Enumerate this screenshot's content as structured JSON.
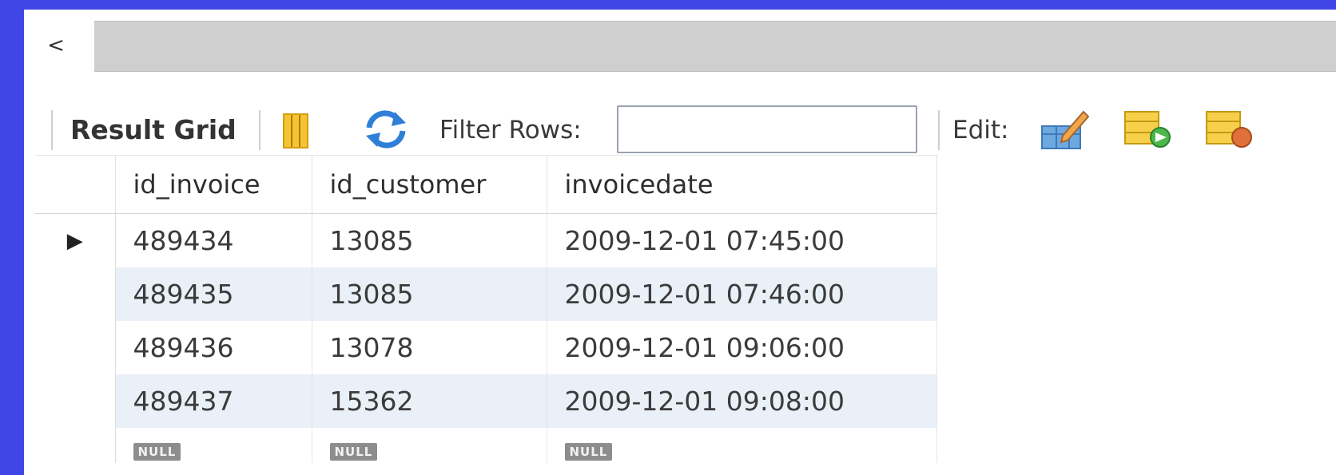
{
  "scroll": {
    "left_arrow": "<"
  },
  "toolbar": {
    "result_grid_label": "Result Grid",
    "filter_label": "Filter Rows:",
    "filter_value": "",
    "edit_label": "Edit:"
  },
  "grid": {
    "columns": [
      "id_invoice",
      "id_customer",
      "invoicedate"
    ],
    "current_row_marker": "▶",
    "rows": [
      [
        "489434",
        "13085",
        "2009-12-01 07:45:00"
      ],
      [
        "489435",
        "13085",
        "2009-12-01 07:46:00"
      ],
      [
        "489436",
        "13078",
        "2009-12-01 09:06:00"
      ],
      [
        "489437",
        "15362",
        "2009-12-01 09:08:00"
      ]
    ],
    "null_label": "NULL"
  }
}
